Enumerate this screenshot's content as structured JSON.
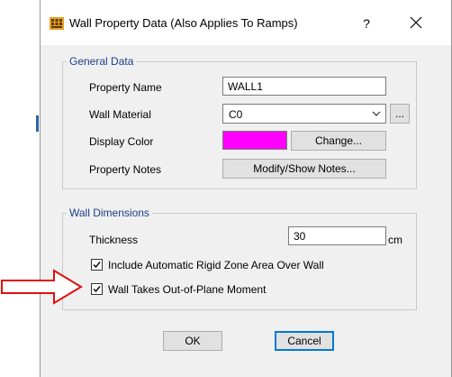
{
  "dialog": {
    "title": "Wall Property Data  (Also Applies To Ramps)",
    "help_label": "?",
    "close_label": "✕"
  },
  "general_data": {
    "legend": "General Data",
    "property_name_label": "Property Name",
    "property_name_value": "WALL1",
    "wall_material_label": "Wall Material",
    "wall_material_value": "C0",
    "wall_material_more_label": "...",
    "display_color_label": "Display Color",
    "display_color_value": "#ff00ff",
    "change_button_label": "Change...",
    "property_notes_label": "Property Notes",
    "modify_notes_button_label": "Modify/Show Notes..."
  },
  "wall_dimensions": {
    "legend": "Wall Dimensions",
    "thickness_label": "Thickness",
    "thickness_value": "30",
    "thickness_unit": "cm",
    "rigid_zone_checkbox_label": "Include Automatic Rigid Zone Area Over Wall",
    "rigid_zone_checked": true,
    "out_of_plane_checkbox_label": "Wall Takes Out-of-Plane Moment",
    "out_of_plane_checked": true
  },
  "footer": {
    "ok_label": "OK",
    "cancel_label": "Cancel"
  },
  "colors": {
    "arrow": "#e01010",
    "legend_text": "#1c3f8c",
    "swatch": "#ff00ff"
  }
}
